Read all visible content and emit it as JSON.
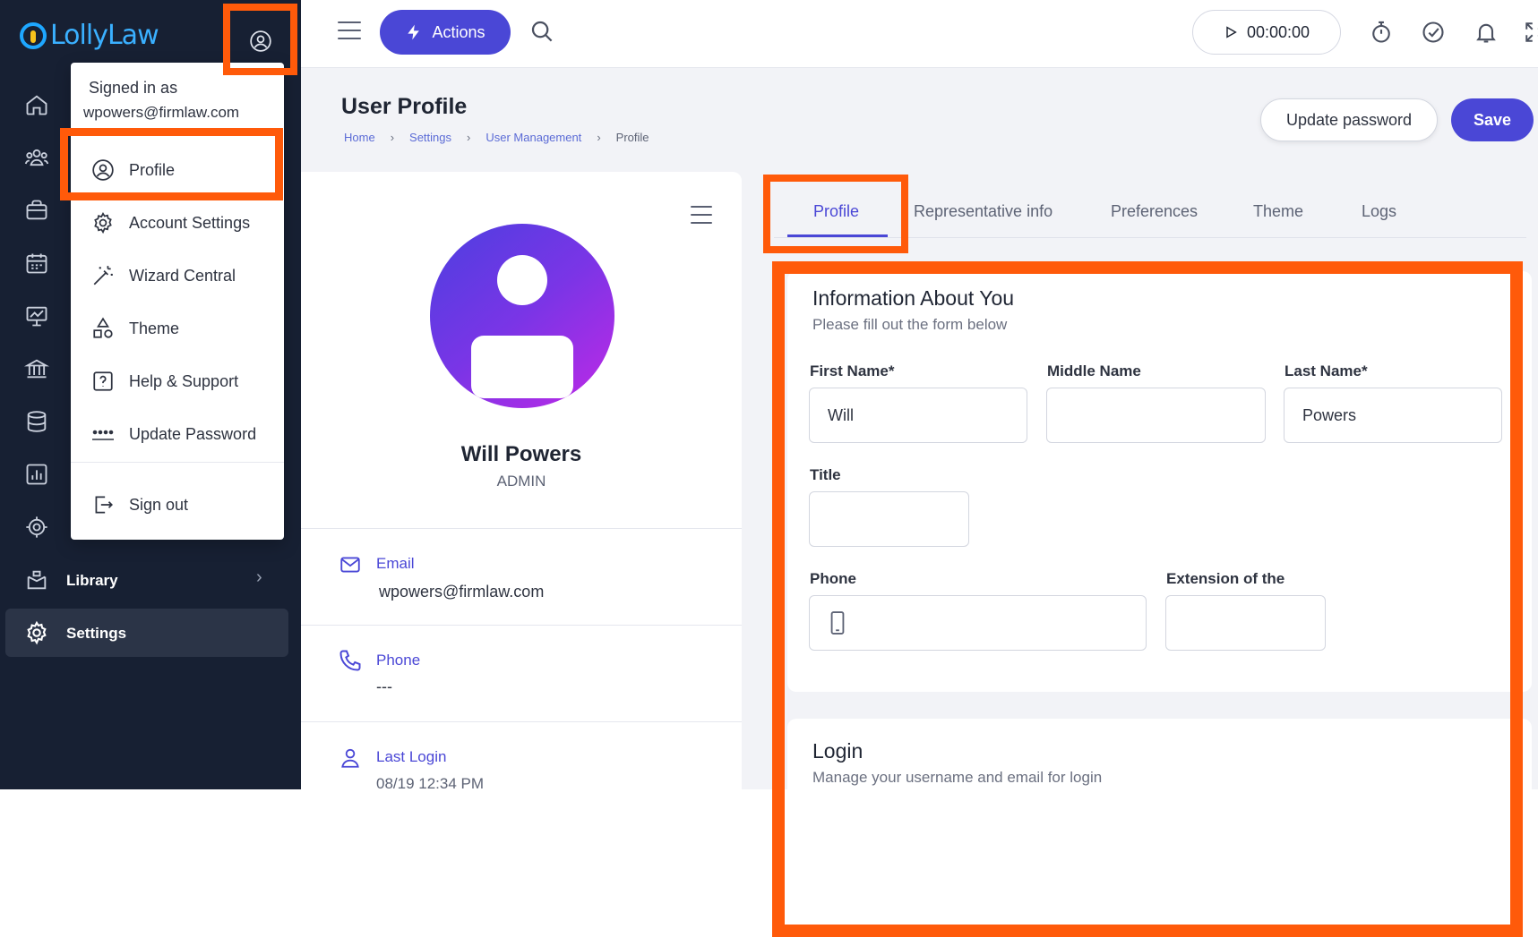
{
  "brand": {
    "name": "LollyLaw"
  },
  "sidebar": {
    "items": [
      {
        "icon": "home-icon"
      },
      {
        "icon": "contacts-icon"
      },
      {
        "icon": "briefcase-icon"
      },
      {
        "icon": "calendar-icon"
      },
      {
        "icon": "presentation-icon"
      },
      {
        "icon": "bank-icon"
      },
      {
        "icon": "database-icon"
      },
      {
        "icon": "reports-icon"
      },
      {
        "icon": "target-icon"
      }
    ],
    "library_label": "Library",
    "settings_label": "Settings"
  },
  "user_menu": {
    "signed_in_label": "Signed in as",
    "email": "wpowers@firmlaw.com",
    "items": [
      {
        "label": "Profile",
        "icon": "user-circle-icon"
      },
      {
        "label": "Account Settings",
        "icon": "gear-icon"
      },
      {
        "label": "Wizard Central",
        "icon": "magic-wand-icon"
      },
      {
        "label": "Theme",
        "icon": "shapes-icon"
      },
      {
        "label": "Help & Support",
        "icon": "help-icon"
      },
      {
        "label": "Update Password",
        "icon": "password-icon"
      }
    ],
    "signout_label": "Sign out"
  },
  "topbar": {
    "actions_label": "Actions",
    "timer": "00:00:00"
  },
  "page": {
    "title": "User Profile",
    "breadcrumb": [
      "Home",
      "Settings",
      "User Management",
      "Profile"
    ],
    "update_password_label": "Update password",
    "save_label": "Save"
  },
  "profile": {
    "name": "Will Powers",
    "role": "ADMIN",
    "email_label": "Email",
    "email": "wpowers@firmlaw.com",
    "phone_label": "Phone",
    "phone": "---",
    "last_login_label": "Last Login",
    "last_login": "08/19 12:34 PM"
  },
  "tabs": [
    "Profile",
    "Representative info",
    "Preferences",
    "Theme",
    "Logs"
  ],
  "active_tab": "Profile",
  "form": {
    "title": "Information About You",
    "subtitle": "Please fill out the form below",
    "first_name_label": "First Name*",
    "first_name": "Will",
    "middle_name_label": "Middle Name",
    "middle_name": "",
    "last_name_label": "Last Name*",
    "last_name": "Powers",
    "title_label": "Title",
    "title_value": "",
    "phone_label": "Phone",
    "phone_value": "",
    "extension_label": "Extension of the",
    "extension_value": ""
  },
  "login": {
    "title": "Login",
    "subtitle": "Manage your username and email for login"
  },
  "colors": {
    "accent": "#4a47d6",
    "sidebar_bg": "#172033",
    "highlight": "#ff5a0a"
  }
}
